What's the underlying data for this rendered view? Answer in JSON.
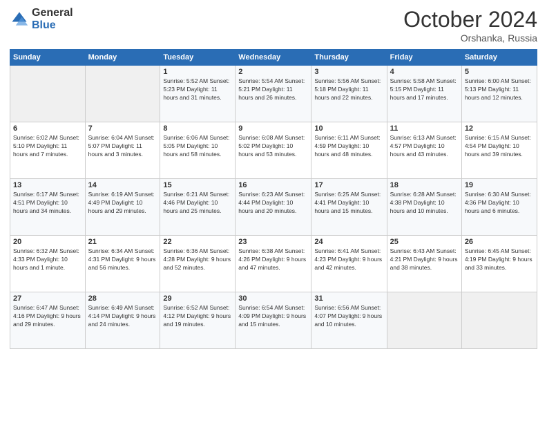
{
  "header": {
    "logo_general": "General",
    "logo_blue": "Blue",
    "month": "October 2024",
    "location": "Orshanka, Russia"
  },
  "weekdays": [
    "Sunday",
    "Monday",
    "Tuesday",
    "Wednesday",
    "Thursday",
    "Friday",
    "Saturday"
  ],
  "weeks": [
    [
      {
        "day": "",
        "info": ""
      },
      {
        "day": "",
        "info": ""
      },
      {
        "day": "1",
        "info": "Sunrise: 5:52 AM\nSunset: 5:23 PM\nDaylight: 11 hours\nand 31 minutes."
      },
      {
        "day": "2",
        "info": "Sunrise: 5:54 AM\nSunset: 5:21 PM\nDaylight: 11 hours\nand 26 minutes."
      },
      {
        "day": "3",
        "info": "Sunrise: 5:56 AM\nSunset: 5:18 PM\nDaylight: 11 hours\nand 22 minutes."
      },
      {
        "day": "4",
        "info": "Sunrise: 5:58 AM\nSunset: 5:15 PM\nDaylight: 11 hours\nand 17 minutes."
      },
      {
        "day": "5",
        "info": "Sunrise: 6:00 AM\nSunset: 5:13 PM\nDaylight: 11 hours\nand 12 minutes."
      }
    ],
    [
      {
        "day": "6",
        "info": "Sunrise: 6:02 AM\nSunset: 5:10 PM\nDaylight: 11 hours\nand 7 minutes."
      },
      {
        "day": "7",
        "info": "Sunrise: 6:04 AM\nSunset: 5:07 PM\nDaylight: 11 hours\nand 3 minutes."
      },
      {
        "day": "8",
        "info": "Sunrise: 6:06 AM\nSunset: 5:05 PM\nDaylight: 10 hours\nand 58 minutes."
      },
      {
        "day": "9",
        "info": "Sunrise: 6:08 AM\nSunset: 5:02 PM\nDaylight: 10 hours\nand 53 minutes."
      },
      {
        "day": "10",
        "info": "Sunrise: 6:11 AM\nSunset: 4:59 PM\nDaylight: 10 hours\nand 48 minutes."
      },
      {
        "day": "11",
        "info": "Sunrise: 6:13 AM\nSunset: 4:57 PM\nDaylight: 10 hours\nand 43 minutes."
      },
      {
        "day": "12",
        "info": "Sunrise: 6:15 AM\nSunset: 4:54 PM\nDaylight: 10 hours\nand 39 minutes."
      }
    ],
    [
      {
        "day": "13",
        "info": "Sunrise: 6:17 AM\nSunset: 4:51 PM\nDaylight: 10 hours\nand 34 minutes."
      },
      {
        "day": "14",
        "info": "Sunrise: 6:19 AM\nSunset: 4:49 PM\nDaylight: 10 hours\nand 29 minutes."
      },
      {
        "day": "15",
        "info": "Sunrise: 6:21 AM\nSunset: 4:46 PM\nDaylight: 10 hours\nand 25 minutes."
      },
      {
        "day": "16",
        "info": "Sunrise: 6:23 AM\nSunset: 4:44 PM\nDaylight: 10 hours\nand 20 minutes."
      },
      {
        "day": "17",
        "info": "Sunrise: 6:25 AM\nSunset: 4:41 PM\nDaylight: 10 hours\nand 15 minutes."
      },
      {
        "day": "18",
        "info": "Sunrise: 6:28 AM\nSunset: 4:38 PM\nDaylight: 10 hours\nand 10 minutes."
      },
      {
        "day": "19",
        "info": "Sunrise: 6:30 AM\nSunset: 4:36 PM\nDaylight: 10 hours\nand 6 minutes."
      }
    ],
    [
      {
        "day": "20",
        "info": "Sunrise: 6:32 AM\nSunset: 4:33 PM\nDaylight: 10 hours\nand 1 minute."
      },
      {
        "day": "21",
        "info": "Sunrise: 6:34 AM\nSunset: 4:31 PM\nDaylight: 9 hours\nand 56 minutes."
      },
      {
        "day": "22",
        "info": "Sunrise: 6:36 AM\nSunset: 4:28 PM\nDaylight: 9 hours\nand 52 minutes."
      },
      {
        "day": "23",
        "info": "Sunrise: 6:38 AM\nSunset: 4:26 PM\nDaylight: 9 hours\nand 47 minutes."
      },
      {
        "day": "24",
        "info": "Sunrise: 6:41 AM\nSunset: 4:23 PM\nDaylight: 9 hours\nand 42 minutes."
      },
      {
        "day": "25",
        "info": "Sunrise: 6:43 AM\nSunset: 4:21 PM\nDaylight: 9 hours\nand 38 minutes."
      },
      {
        "day": "26",
        "info": "Sunrise: 6:45 AM\nSunset: 4:19 PM\nDaylight: 9 hours\nand 33 minutes."
      }
    ],
    [
      {
        "day": "27",
        "info": "Sunrise: 6:47 AM\nSunset: 4:16 PM\nDaylight: 9 hours\nand 29 minutes."
      },
      {
        "day": "28",
        "info": "Sunrise: 6:49 AM\nSunset: 4:14 PM\nDaylight: 9 hours\nand 24 minutes."
      },
      {
        "day": "29",
        "info": "Sunrise: 6:52 AM\nSunset: 4:12 PM\nDaylight: 9 hours\nand 19 minutes."
      },
      {
        "day": "30",
        "info": "Sunrise: 6:54 AM\nSunset: 4:09 PM\nDaylight: 9 hours\nand 15 minutes."
      },
      {
        "day": "31",
        "info": "Sunrise: 6:56 AM\nSunset: 4:07 PM\nDaylight: 9 hours\nand 10 minutes."
      },
      {
        "day": "",
        "info": ""
      },
      {
        "day": "",
        "info": ""
      }
    ]
  ]
}
